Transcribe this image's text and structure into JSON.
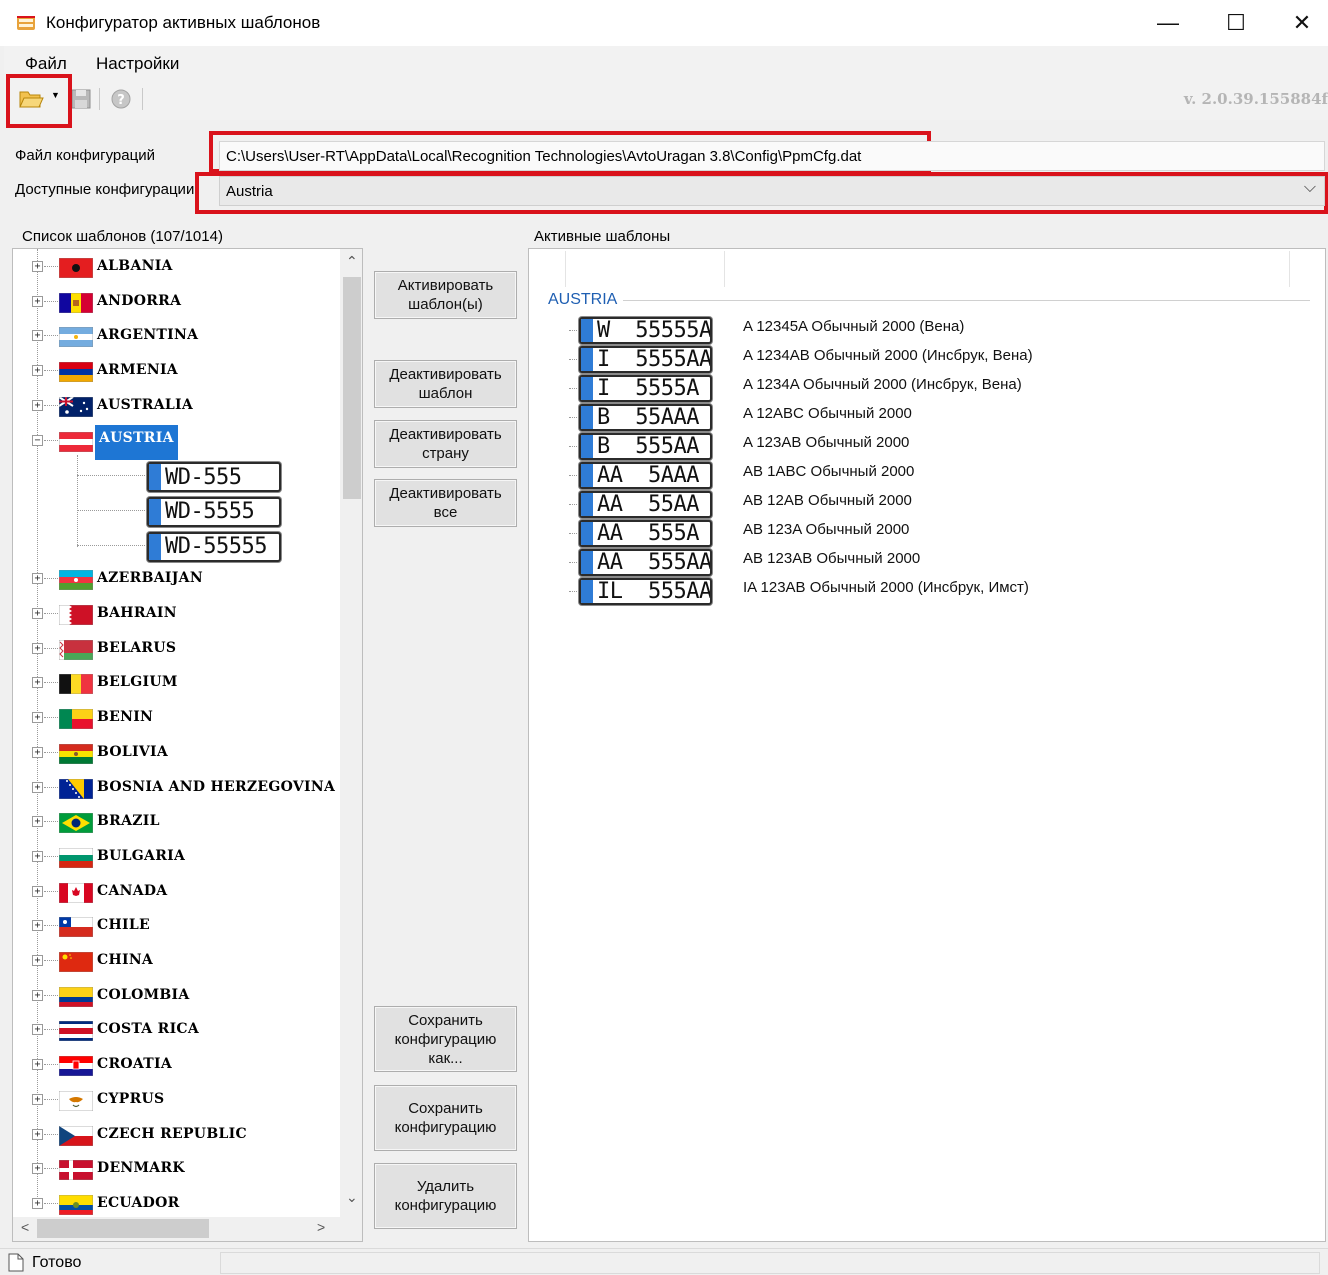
{
  "window": {
    "title": "Конфигуратор активных шаблонов",
    "minimize": "—",
    "maximize": "☐",
    "close": "✕"
  },
  "menu": {
    "file": "Файл",
    "settings": "Настройки"
  },
  "toolbar": {
    "version": "v. 2.0.39.155884f",
    "icons": [
      "open-folder-icon",
      "dropdown-arrow-icon",
      "save-disk-icon",
      "help-icon"
    ]
  },
  "config": {
    "file_label": "Файл конфигураций",
    "file_path": "C:\\Users\\User-RT\\AppData\\Local\\Recognition Technologies\\AvtoUragan 3.8\\Config\\PpmCfg.dat",
    "available_label": "Доступные конфигурации",
    "selected_config": "Austria"
  },
  "template_list": {
    "title": "Список шаблонов (107/1014)",
    "countries": [
      {
        "name": "ALBANIA",
        "flag": "albania"
      },
      {
        "name": "ANDORRA",
        "flag": "andorra"
      },
      {
        "name": "ARGENTINA",
        "flag": "argentina"
      },
      {
        "name": "ARMENIA",
        "flag": "armenia"
      },
      {
        "name": "AUSTRALIA",
        "flag": "australia"
      },
      {
        "name": "AUSTRIA",
        "flag": "austria",
        "expanded": true,
        "selected": true
      },
      {
        "name": "AZERBAIJAN",
        "flag": "azerbaijan"
      },
      {
        "name": "BAHRAIN",
        "flag": "bahrain"
      },
      {
        "name": "BELARUS",
        "flag": "belarus"
      },
      {
        "name": "BELGIUM",
        "flag": "belgium"
      },
      {
        "name": "BENIN",
        "flag": "benin"
      },
      {
        "name": "BOLIVIA",
        "flag": "bolivia"
      },
      {
        "name": "BOSNIA AND HERZEGOVINA",
        "flag": "bosnia"
      },
      {
        "name": "BRAZIL",
        "flag": "brazil"
      },
      {
        "name": "BULGARIA",
        "flag": "bulgaria"
      },
      {
        "name": "CANADA",
        "flag": "canada"
      },
      {
        "name": "CHILE",
        "flag": "chile"
      },
      {
        "name": "CHINA",
        "flag": "china"
      },
      {
        "name": "COLOMBIA",
        "flag": "colombia"
      },
      {
        "name": "COSTA RICA",
        "flag": "costarica"
      },
      {
        "name": "CROATIA",
        "flag": "croatia"
      },
      {
        "name": "CYPRUS",
        "flag": "cyprus"
      },
      {
        "name": "CZECH REPUBLIC",
        "flag": "czech"
      },
      {
        "name": "DENMARK",
        "flag": "denmark"
      },
      {
        "name": "ECUADOR",
        "flag": "ecuador"
      }
    ],
    "austria_children": [
      "WD-555",
      "WD-5555",
      "WD-55555"
    ]
  },
  "buttons": {
    "activate": "Активировать\nшаблон(ы)",
    "deactivate_template": "Деактивировать\nшаблон",
    "deactivate_country": "Деактивировать\nстрану",
    "deactivate_all": "Деактивировать\nвсе",
    "save_as": "Сохранить\nконфигурацию\nкак...",
    "save": "Сохранить\nконфигурацию",
    "delete": "Удалить\nконфигурацию"
  },
  "active_templates": {
    "title": "Активные шаблоны",
    "group": "AUSTRIA",
    "items": [
      {
        "plate": "W  55555A",
        "desc": "A 12345A Обычный 2000 (Вена)"
      },
      {
        "plate": "I  5555AA",
        "desc": "A 1234AB Обычный 2000 (Инсбрук, Вена)"
      },
      {
        "plate": "I  5555A",
        "desc": "A 1234A Обычный 2000 (Инсбрук, Вена)"
      },
      {
        "plate": "B  55AAA",
        "desc": "A 12ABC Обычный 2000"
      },
      {
        "plate": "B  555AA",
        "desc": "A 123AB Обычный 2000"
      },
      {
        "plate": "AA  5AAA",
        "desc": "AB 1ABC Обычный 2000"
      },
      {
        "plate": "AA  55AA",
        "desc": "AB 12AB Обычный 2000"
      },
      {
        "plate": "AA  555A",
        "desc": "AB 123A Обычный 2000"
      },
      {
        "plate": "AA  555AA",
        "desc": "AB 123AB Обычный 2000"
      },
      {
        "plate": "IL  555AA",
        "desc": "IA 123AB Обычный 2000 (Инсбрук, Имст)"
      }
    ]
  },
  "status": {
    "text": "Готово"
  },
  "colors": {
    "highlight": "#d9121b",
    "selection": "#1e76d4",
    "group_title": "#1f5fb2",
    "plate_blue": "#2f7cd6"
  }
}
